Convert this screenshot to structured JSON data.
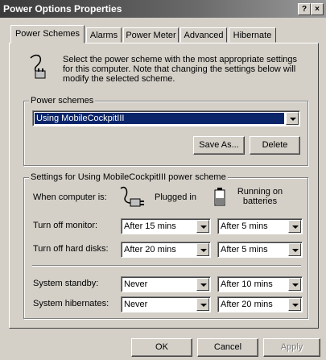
{
  "window": {
    "title": "Power Options Properties",
    "help_label": "?",
    "close_label": "×"
  },
  "tabs": [
    {
      "label": "Power Schemes"
    },
    {
      "label": "Alarms"
    },
    {
      "label": "Power Meter"
    },
    {
      "label": "Advanced"
    },
    {
      "label": "Hibernate"
    }
  ],
  "intro_text": "Select the power scheme with the most appropriate settings for this computer. Note that changing the settings below will modify the selected scheme.",
  "schemes": {
    "group_label": "Power schemes",
    "selected": "Using MobileCockpitIII",
    "save_as_label": "Save As...",
    "delete_label": "Delete"
  },
  "settings": {
    "group_label": "Settings for Using MobileCockpitIII power scheme",
    "when_label": "When computer is:",
    "plugged_label": "Plugged in",
    "battery_label": "Running on batteries",
    "rows": [
      {
        "label": "Turn off monitor:",
        "plugged": "After 15 mins",
        "battery": "After 5 mins"
      },
      {
        "label": "Turn off hard disks:",
        "plugged": "After 20 mins",
        "battery": "After 5 mins"
      },
      {
        "label": "System standby:",
        "plugged": "Never",
        "battery": "After 10 mins"
      },
      {
        "label": "System hibernates:",
        "plugged": "Never",
        "battery": "After 20 mins"
      }
    ]
  },
  "footer": {
    "ok_label": "OK",
    "cancel_label": "Cancel",
    "apply_label": "Apply"
  },
  "icons": [
    "power-plug-icon",
    "plugged-in-icon",
    "battery-icon"
  ]
}
